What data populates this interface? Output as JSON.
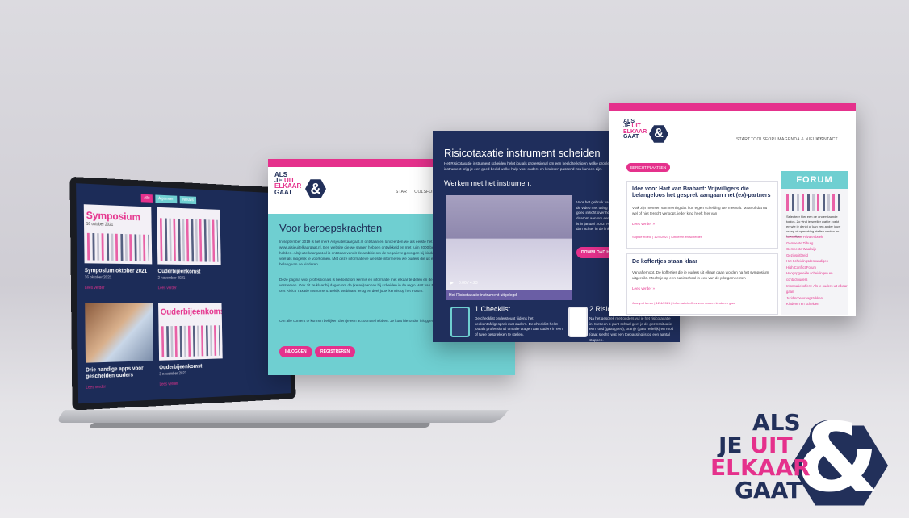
{
  "laptop": {
    "tags": [
      "Alle",
      "Algemeen",
      "Nieuws"
    ],
    "cards": [
      {
        "title": "Symposium",
        "date": "16 oktober 2021",
        "caption": "Symposium oktober 2021",
        "meta": "16 oktober 2021",
        "link": "Lees verder"
      },
      {
        "title": "",
        "date": "",
        "caption": "Ouderbijeenkomst",
        "meta": "2 november 2021",
        "link": "Lees verder"
      },
      {
        "title": "",
        "date": "",
        "caption": "Drie handige apps voor gescheiden ouders",
        "meta": "",
        "link": "Lees verder"
      },
      {
        "title": "Ouderbijeenkomst",
        "date": "",
        "caption": "Ouderbijeenkomst",
        "meta": "3 november 2021",
        "link": "Lees verder"
      }
    ]
  },
  "panel1": {
    "logo": {
      "line1": "ALS",
      "line2a": "JE",
      "line2b": "UIT",
      "line3": "ELKAAR",
      "line4": "GAAT",
      "mark": "&"
    },
    "nav": [
      "START",
      "TOOLS",
      "FOR"
    ],
    "title": "Voor beroepskrachten",
    "paragraphs": [
      "In september 2019 is het merk Alsjeuitelkaargaat.nl ontstaan en lanceerden we als eerste het online scheidingsloket www.alsjeuitelkaargaat.nl. Een website die we samen hebben ontwikkeld en met ruim 2000 bezoekers per maand een groot bereik hebben. Alsjeuitelkaargaat.nl is ontstaan vanuit de ambitie om de negatieve gevolgen bij kinderen en jongeren van gescheiden ouders zo veel als mogelijk te voorkomen. Met deze informatieve website informeren we ouders die uit elkaar gaan hoe dit goed te doen. In het belang van de kinderen.",
      "Deze pagina voor professionals is bedoeld om kennis en informatie met elkaar te delen en de samenwerking en verbinding in de keten te versterken. Ook zit ze klaar bij dagen om de (keten)aanpak bij scheiden in de regio Hart van Brabant te bevorderen. Maak gebruik van ons Risico Taxatie Instrument. Bekijk Webinars terug en deel jouw kennis op het Forum.",
      "Om alle content te kunnen bekijken dien je een account te hebben. Je kunt hieronder inloggen of je registreren voor een account."
    ],
    "buttons": {
      "login": "INLOGGEN",
      "register": "REGISTREREN"
    }
  },
  "panel2": {
    "title": "Risicotaxatie instrument scheiden",
    "intro": "Het Risicotaxatie instrument scheiden helpt jou als professional om een beeld te krijgen welke problemen er spelen en kinderen. Met het instrument krijg je een goed beeld welke hulp voor ouders en kinderen passend zou kunnen zijn.",
    "subtitle": "Werken met het instrument",
    "video_time": "0:00 / 4:23",
    "video_caption": "Het Risicotaxatie instrument uitgelegd",
    "side_text": "Voor het gebruik van het Risicotaxatie instrument bekijk je de video met uitleg hiernaast en kun je het instrument goed inzicht over hoe het instrument werkt. Meld je daarom aan om een training te volgen. De eerstvolgende is in januari 2022. Heb je interesse in deze training, volg dan achter in de link hierboven.",
    "download_btn": "DOWNLOAD HANDLEIDING",
    "checklist_title": "1 Checklist",
    "checklist_text": "De checklist ondersteunt tijdens het keukentafelgesprek met ouders. De checklist helpt jou als professional om alle vragen aan ouders in een of twee gesprekken te stellen.",
    "item2_title": "2 Risicotax",
    "item2_text": "Na het gesprek met ouders vul je het risicotaxatie in. Met een 5-punt schaal geef je de gezinssituatie een rood (gaat goed), oranje (gaat redelijk) en rood (gaat slecht) wat een toepassing is op een aantal stappen."
  },
  "panel3": {
    "nav": [
      "START",
      "TOOLS",
      "FORUM",
      "AGENDA & NIEUWS",
      "CONTACT"
    ],
    "post_button": "BERICHT PLAATSEN",
    "posts": [
      {
        "title": "Idee voor Hart van Brabant: Vrijwilligers die belangeloos het gesprek aangaan met (ex)-partners",
        "text": "Vlak zijn mensen van mening dat hun eigen scheiding wel meevalt. Maar of dat nu wel of niet terecht verloopt, ieder kind heeft hier van",
        "link": "Lees verder »",
        "meta": "Sophie Roelo | 12/4/2021 | Kinderen en scheiden"
      },
      {
        "title": "De koffertjes staan klaar",
        "text": "Van afternoot. De koffertjes die je ouders uit elkaar gaan worden na het symposium uitgereikt. Mocht je op een basisschool in een van de pilotgemeenten",
        "link": "Lees verder »",
        "meta": "Jeanyn Harren | 12/4/2021 | Informatiekoffers voor ouders kinderen gaat"
      }
    ],
    "forum": {
      "heading": "FORUM",
      "intro": "Selecteer hier een de onderstaande topics. Zo vind je sneller wat je zoekt en wie je denkt of kan een ander jouw vraag of opmerking stellen vinden en bevestigen.",
      "topics": [
        "Gemeente Hilvarenbeek",
        "Gemeente Tilburg",
        "Gemeente Waalwijk",
        "Gezinsuitbreid",
        "Het Scheidingsdeskundigen",
        "High Conflict Forum",
        "Hoogopgeleide scheidingen en contactouders",
        "Informatiekoffers: Als je ouders uit elkaar gaan",
        "Juridische vraagstukken",
        "Kinderen en scheiden"
      ]
    }
  },
  "brand_logo": {
    "line1": "ALS",
    "line2a": "JE",
    "line2b": "UIT",
    "line3": "ELKAAR",
    "line4": "GAAT",
    "mark": "&"
  },
  "colors": {
    "pink": "#e5318c",
    "navy": "#22305a",
    "teal": "#6fcfd1"
  }
}
